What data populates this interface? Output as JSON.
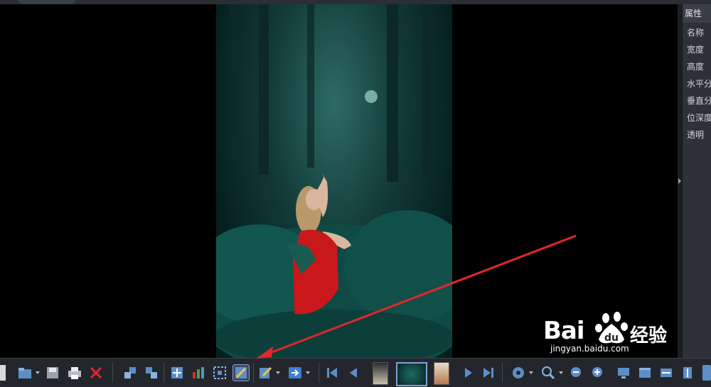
{
  "properties_panel": {
    "title": "属性",
    "rows": [
      "名称",
      "宽度",
      "高度",
      "水平分",
      "垂直分",
      "位深度",
      "透明"
    ]
  },
  "toolbar": {
    "buttons": [
      "back-icon",
      "open-folder-icon",
      "save-icon",
      "print-icon",
      "delete-icon",
      "rotate-left-icon",
      "rotate-right-icon",
      "fit-icon",
      "chart-icon",
      "crop-icon",
      "draw-icon",
      "edit-icon",
      "export-arrow-icon",
      "first-icon",
      "prev-icon",
      "next-icon",
      "last-icon",
      "settings-icon",
      "zoom-icon",
      "zoom-out-icon",
      "zoom-in-icon",
      "monitor-icon",
      "window-icon",
      "fit-width-icon",
      "fit-height-icon"
    ]
  },
  "watermark": {
    "brand": "Bai",
    "brand_cn": "经验",
    "url": "jingyan.baidu.com"
  },
  "colors": {
    "annotation_arrow": "#e2262a",
    "selection": "#7fa3d8"
  }
}
